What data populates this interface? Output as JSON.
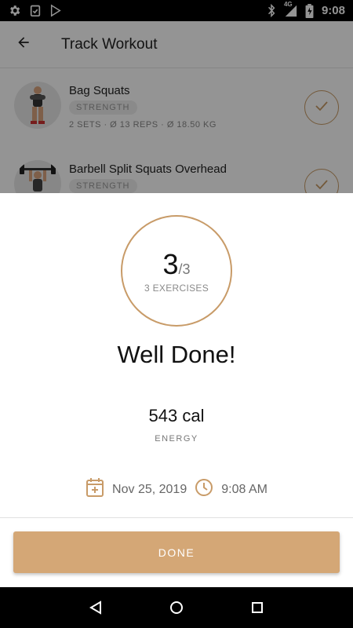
{
  "status_bar": {
    "time": "9:08",
    "network": "4G",
    "icons": [
      "settings-icon",
      "clipboard-check-icon",
      "play-store-icon",
      "bluetooth-icon",
      "signal-icon",
      "battery-icon"
    ]
  },
  "app_bar": {
    "title": "Track Workout",
    "back_icon": "arrow-back-icon"
  },
  "workout": {
    "exercises": [
      {
        "name": "Bag Squats",
        "tag": "STRENGTH",
        "stats": "2 SETS  ·  Ø 13 REPS  ·  Ø 18.50 KG"
      },
      {
        "name": "Barbell Split Squats Overhead",
        "tag": "STRENGTH",
        "stats": ""
      }
    ]
  },
  "summary": {
    "completed": "3",
    "total": "/3",
    "exercises_label": "3 EXERCISES",
    "headline": "Well Done!",
    "energy_value": "543 cal",
    "energy_label": "ENERGY",
    "date": "Nov 25, 2019",
    "time": "9:08 AM",
    "done_label": "DONE"
  },
  "colors": {
    "accent": "#c89b68",
    "button": "#d4a776",
    "scrim": "rgba(0,0,0,0.42)"
  },
  "nav": {
    "icons": [
      "back-triangle-icon",
      "home-circle-icon",
      "recents-square-icon"
    ]
  }
}
